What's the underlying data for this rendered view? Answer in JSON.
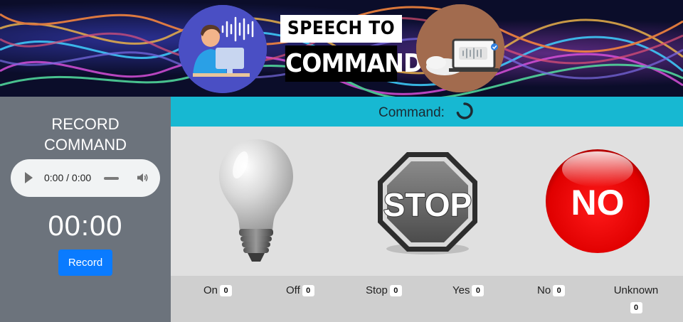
{
  "banner": {
    "title_line1": "SPEECH TO",
    "title_line2": "COMMAND",
    "left_icon": "person-at-computer-soundwave-icon",
    "right_icon": "laptop-voice-message-icon"
  },
  "sidebar": {
    "record_title_line1": "RECORD",
    "record_title_line2": "COMMAND",
    "player_time": "0:00 / 0:00",
    "timer": "00:00",
    "record_label": "Record"
  },
  "command_bar": {
    "label": "Command:",
    "status_icon": "loading-spinner-icon"
  },
  "command_images": [
    {
      "name": "lightbulb",
      "icon": "lightbulb-icon"
    },
    {
      "name": "stop-sign",
      "icon": "stop-sign-icon",
      "text": "STOP"
    },
    {
      "name": "no-button",
      "icon": "no-button-icon",
      "text": "NO"
    }
  ],
  "counts": [
    {
      "label": "On",
      "count": "0"
    },
    {
      "label": "Off",
      "count": "0"
    },
    {
      "label": "Stop",
      "count": "0"
    },
    {
      "label": "Yes",
      "count": "0"
    },
    {
      "label": "No",
      "count": "0"
    },
    {
      "label": "Unknown",
      "count": "0"
    }
  ],
  "colors": {
    "command_bar": "#17b8d2",
    "sidebar": "#6c737c",
    "record_button": "#0a7bff",
    "no_button": "#ff0000"
  }
}
